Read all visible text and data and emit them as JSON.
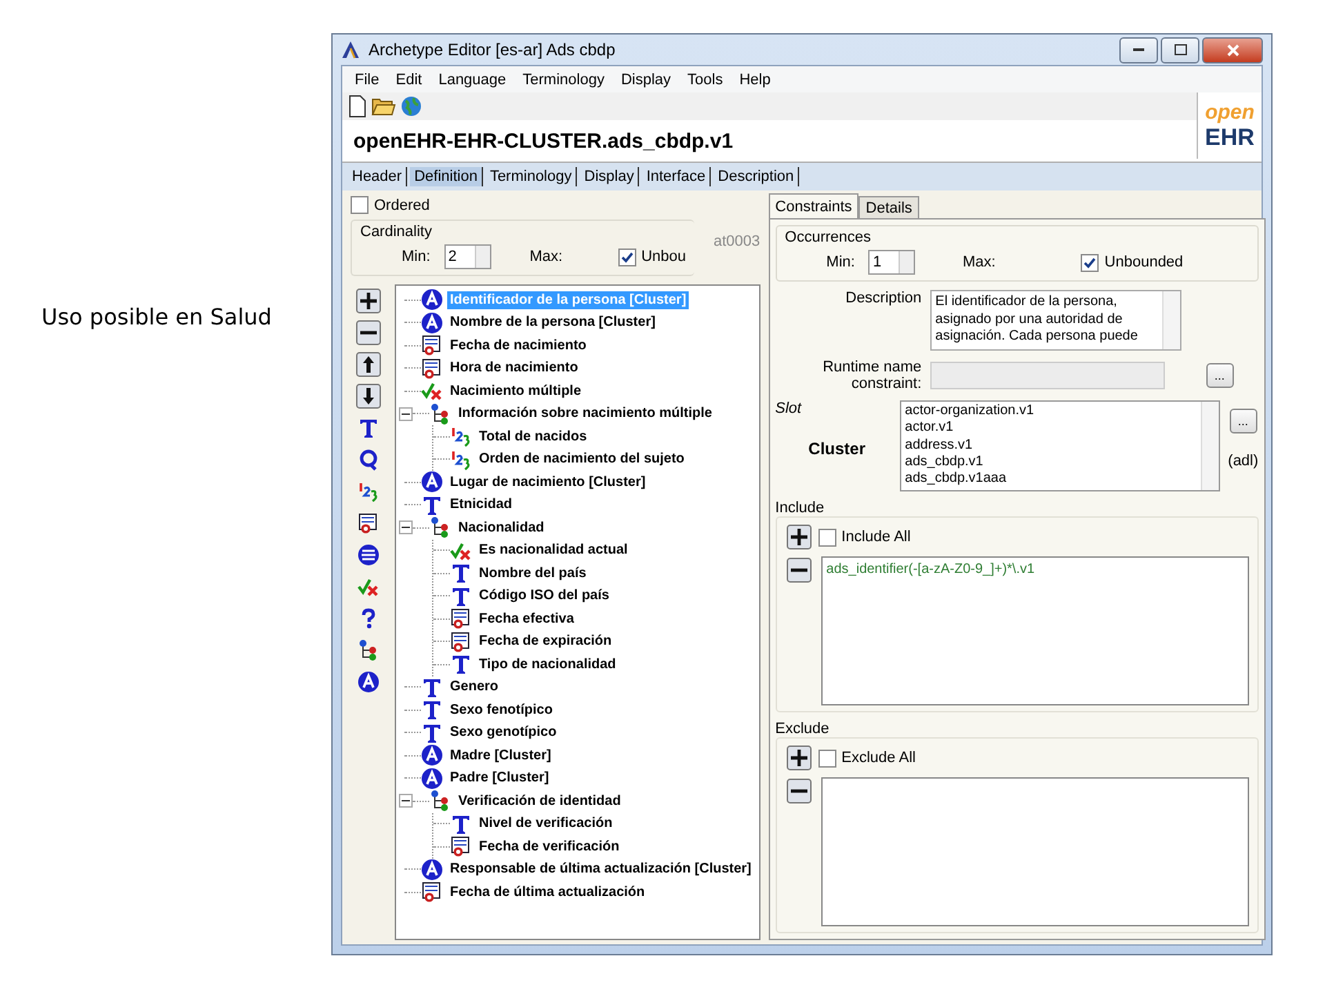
{
  "caption": "Uso posible en Salud",
  "window": {
    "title": "Archetype Editor [es-ar] Ads cbdp"
  },
  "menu": [
    "File",
    "Edit",
    "Language",
    "Terminology",
    "Display",
    "Tools",
    "Help"
  ],
  "archetype_id": "openEHR-EHR-CLUSTER.ads_cbdp.v1",
  "logo": {
    "line_1": "open",
    "line_2": "EHR"
  },
  "main_tabs": [
    {
      "label": "Header",
      "selected": false
    },
    {
      "label": "Definition",
      "selected": true
    },
    {
      "label": "Terminology",
      "selected": false
    },
    {
      "label": "Display",
      "selected": false
    },
    {
      "label": "Interface",
      "selected": false
    },
    {
      "label": "Description",
      "selected": false
    }
  ],
  "definition": {
    "ordered": {
      "label": "Ordered",
      "checked": false
    },
    "cardinality": {
      "title": "Cardinality",
      "min_label": "Min:",
      "min": "2",
      "max_label": "Max:",
      "unbounded": {
        "label": "Unbou",
        "checked": true
      }
    },
    "node_code": "at0003",
    "palette": [
      {
        "kind": "add"
      },
      {
        "kind": "remove"
      },
      {
        "kind": "up"
      },
      {
        "kind": "down"
      },
      {
        "kind": "text"
      },
      {
        "kind": "quantity"
      },
      {
        "kind": "count"
      },
      {
        "kind": "datetime"
      },
      {
        "kind": "list"
      },
      {
        "kind": "boolean"
      },
      {
        "kind": "any"
      },
      {
        "kind": "group"
      },
      {
        "kind": "cluster"
      }
    ],
    "tree": [
      {
        "label": "Identificador de la persona [Cluster]",
        "kind": "cluster",
        "selected": true
      },
      {
        "label": "Nombre de la persona [Cluster]",
        "kind": "cluster",
        "selected": false
      },
      {
        "label": "Fecha de nacimiento",
        "kind": "datetime",
        "selected": false
      },
      {
        "label": "Hora de nacimiento",
        "kind": "datetime",
        "selected": false
      },
      {
        "label": "Nacimiento múltiple",
        "kind": "boolean",
        "selected": false
      },
      {
        "label": "Información sobre nacimiento múltiple",
        "kind": "group",
        "selected": false,
        "expanded": true,
        "children": [
          {
            "label": "Total de nacidos",
            "kind": "count",
            "selected": false
          },
          {
            "label": "Orden de nacimiento del sujeto",
            "kind": "count",
            "selected": false
          }
        ]
      },
      {
        "label": "Lugar de nacimiento [Cluster]",
        "kind": "cluster",
        "selected": false
      },
      {
        "label": "Etnicidad",
        "kind": "text",
        "selected": false
      },
      {
        "label": "Nacionalidad",
        "kind": "group",
        "selected": false,
        "expanded": true,
        "children": [
          {
            "label": "Es nacionalidad actual",
            "kind": "boolean",
            "selected": false
          },
          {
            "label": "Nombre del país",
            "kind": "text",
            "selected": false
          },
          {
            "label": "Código ISO del país",
            "kind": "text",
            "selected": false
          },
          {
            "label": "Fecha efectiva",
            "kind": "datetime",
            "selected": false
          },
          {
            "label": "Fecha de expiración",
            "kind": "datetime",
            "selected": false
          },
          {
            "label": "Tipo de nacionalidad",
            "kind": "text",
            "selected": false
          }
        ]
      },
      {
        "label": "Genero",
        "kind": "text",
        "selected": false
      },
      {
        "label": "Sexo fenotípico",
        "kind": "text",
        "selected": false
      },
      {
        "label": "Sexo genotípico",
        "kind": "text",
        "selected": false
      },
      {
        "label": "Madre [Cluster]",
        "kind": "cluster",
        "selected": false
      },
      {
        "label": "Padre [Cluster]",
        "kind": "cluster",
        "selected": false
      },
      {
        "label": "Verificación de identidad",
        "kind": "group",
        "selected": false,
        "expanded": true,
        "children": [
          {
            "label": "Nivel de verificación",
            "kind": "text",
            "selected": false
          },
          {
            "label": "Fecha de verificación",
            "kind": "datetime",
            "selected": false
          }
        ]
      },
      {
        "label": "Responsable de última actualización [Cluster]",
        "kind": "cluster",
        "selected": false
      },
      {
        "label": "Fecha de última actualización",
        "kind": "datetime",
        "selected": false
      }
    ]
  },
  "constraints": {
    "tabs": [
      {
        "label": "Constraints",
        "selected": true
      },
      {
        "label": "Details",
        "selected": false
      }
    ],
    "occurrences": {
      "title": "Occurrences",
      "min_label": "Min:",
      "min": "1",
      "max_label": "Max:",
      "unbounded": {
        "label": "Unbounded",
        "checked": true
      }
    },
    "description": {
      "label": "Description",
      "text": "El identificador de la persona, asignado por una autoridad de asignación. Cada persona puede"
    },
    "runtime": {
      "label": "Runtime name constraint:",
      "button": "..."
    },
    "slot": {
      "label": "Slot",
      "type": "Cluster",
      "items": [
        "actor-organization.v1",
        "actor.v1",
        "address.v1",
        "ads_cbdp.v1",
        "ads_cbdp.v1aaa"
      ],
      "button": "...",
      "syntax": "(adl)"
    },
    "include": {
      "title": "Include",
      "all": {
        "label": "Include All",
        "checked": false
      },
      "patterns": [
        "ads_identifier(-[a-zA-Z0-9_]+)*\\.v1"
      ]
    },
    "exclude": {
      "title": "Exclude",
      "all": {
        "label": "Exclude All",
        "checked": false
      }
    }
  }
}
